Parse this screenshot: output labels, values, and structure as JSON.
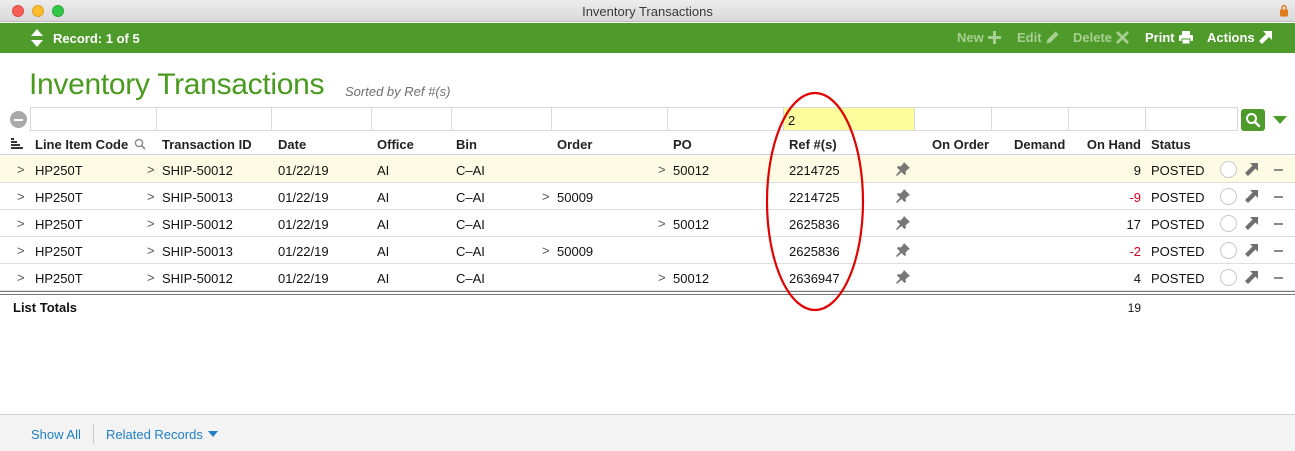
{
  "window": {
    "title": "Inventory Transactions"
  },
  "toolbar": {
    "record_label": "Record: 1 of 5",
    "new_label": "New",
    "edit_label": "Edit",
    "delete_label": "Delete",
    "print_label": "Print",
    "actions_label": "Actions"
  },
  "page": {
    "title": "Inventory Transactions",
    "sort_label": "Sorted by Ref #(s)"
  },
  "filter": {
    "ref_value": "2"
  },
  "columns": {
    "line_item_code": "Line Item Code",
    "transaction_id": "Transaction ID",
    "date": "Date",
    "office": "Office",
    "bin": "Bin",
    "order": "Order",
    "po": "PO",
    "ref": "Ref #(s)",
    "on_order": "On Order",
    "demand": "Demand",
    "on_hand": "On Hand",
    "status": "Status"
  },
  "rows": [
    {
      "line_item_code": "HP250T",
      "transaction_id": "SHIP-50012",
      "date": "01/22/19",
      "office": "AI",
      "bin": "C–AI",
      "order": "",
      "po": "50012",
      "ref": "2214725",
      "on_hand": "9",
      "status": "POSTED"
    },
    {
      "line_item_code": "HP250T",
      "transaction_id": "SHIP-50013",
      "date": "01/22/19",
      "office": "AI",
      "bin": "C–AI",
      "order": "50009",
      "po": "",
      "ref": "2214725",
      "on_hand": "-9",
      "status": "POSTED"
    },
    {
      "line_item_code": "HP250T",
      "transaction_id": "SHIP-50012",
      "date": "01/22/19",
      "office": "AI",
      "bin": "C–AI",
      "order": "",
      "po": "50012",
      "ref": "2625836",
      "on_hand": "17",
      "status": "POSTED"
    },
    {
      "line_item_code": "HP250T",
      "transaction_id": "SHIP-50013",
      "date": "01/22/19",
      "office": "AI",
      "bin": "C–AI",
      "order": "50009",
      "po": "",
      "ref": "2625836",
      "on_hand": "-2",
      "status": "POSTED"
    },
    {
      "line_item_code": "HP250T",
      "transaction_id": "SHIP-50012",
      "date": "01/22/19",
      "office": "AI",
      "bin": "C–AI",
      "order": "",
      "po": "50012",
      "ref": "2636947",
      "on_hand": "4",
      "status": "POSTED"
    }
  ],
  "totals": {
    "label": "List Totals",
    "on_hand": "19"
  },
  "footer": {
    "show_all": "Show All",
    "related_records": "Related Records"
  },
  "colors": {
    "accent": "#4e9a2a",
    "title": "#4a9a20",
    "negative": "#d1001e",
    "link": "#1f7fc4",
    "annotation": "#e00000",
    "highlight": "#fdfd9e"
  }
}
